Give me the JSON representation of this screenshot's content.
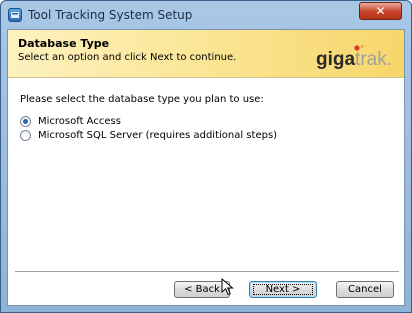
{
  "window": {
    "title": "Tool Tracking System Setup",
    "close_label": "✕"
  },
  "header": {
    "title": "Database Type",
    "subtitle": "Select an option and click Next to continue.",
    "logo_strong": "giga",
    "logo_light": "trak."
  },
  "body": {
    "prompt": "Please select the database type you plan to use:",
    "options": [
      {
        "label": "Microsoft Access",
        "selected": true
      },
      {
        "label": "Microsoft SQL Server (requires additional steps)",
        "selected": false
      }
    ]
  },
  "buttons": {
    "back": "< Back",
    "next": "Next >",
    "cancel": "Cancel"
  }
}
